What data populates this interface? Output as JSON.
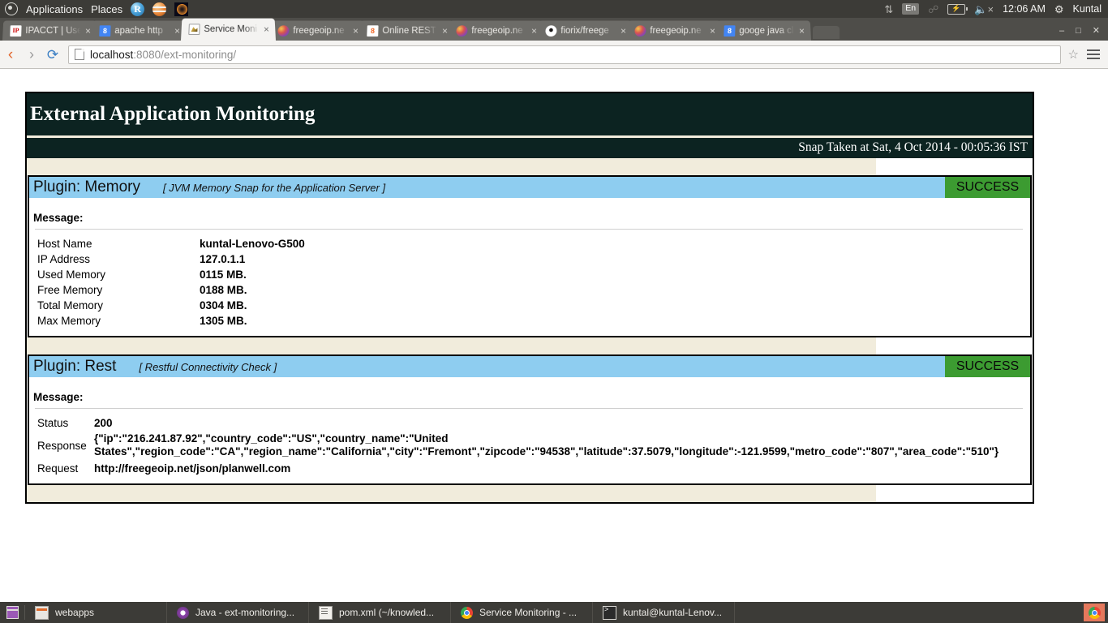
{
  "os_panel": {
    "activities_label": "Applications",
    "places_label": "Places",
    "apps": [
      {
        "name": "r-statistics-icon",
        "label": "R"
      },
      {
        "name": "globe-browser-icon",
        "label": ""
      },
      {
        "name": "eclipse-icon",
        "label": ""
      }
    ],
    "tray": {
      "network_icon": "network-updown-icon",
      "keyboard_layout": "En",
      "bluetooth_icon": "bluetooth-icon",
      "battery_icon": "battery-charging-icon",
      "volume_icon": "volume-muted-icon",
      "clock": "12:06 AM",
      "settings_icon": "gear-icon",
      "user": "Kuntal"
    }
  },
  "browser": {
    "tabs": [
      {
        "title": "IPACCT | Use",
        "favicon": "ipacct-favicon",
        "active": false,
        "close_label": "×"
      },
      {
        "title": "apache http",
        "favicon": "google-8-favicon",
        "active": false,
        "close_label": "×"
      },
      {
        "title": "Service Moni",
        "favicon": "service-monitoring-favicon",
        "active": true,
        "close_label": "×"
      },
      {
        "title": "freegeoip.ne",
        "favicon": "freegeoip-favicon",
        "active": false,
        "close_label": "×"
      },
      {
        "title": "Online REST",
        "favicon": "online-rest-favicon",
        "active": false,
        "close_label": "×"
      },
      {
        "title": "freegeoip.ne",
        "favicon": "freegeoip-favicon",
        "active": false,
        "close_label": "×"
      },
      {
        "title": "fiorix/freege",
        "favicon": "github-favicon",
        "active": false,
        "close_label": "×"
      },
      {
        "title": "freegeoip.ne",
        "favicon": "freegeoip-favicon",
        "active": false,
        "close_label": "×"
      },
      {
        "title": "googe java cl",
        "favicon": "google-8-favicon",
        "active": false,
        "close_label": "×"
      }
    ],
    "window_controls": {
      "minimize": "–",
      "maximize": "□",
      "close": "✕"
    },
    "nav": {
      "back_label": "‹",
      "forward_label": "›",
      "reload_label": "⟳"
    },
    "omnibox": {
      "url_host": "localhost",
      "url_rest": ":8080/ext-monitoring/",
      "bookmark_star": "☆"
    }
  },
  "page": {
    "title": "External Application Monitoring",
    "snap_taken": "Snap Taken at Sat, 4 Oct 2014 - 00:05:36 IST",
    "message_label": "Message:",
    "plugins": [
      {
        "name": "Plugin: Memory",
        "description": "[ JVM Memory Snap for the Application Server ]",
        "status": "SUCCESS",
        "status_color": "#3c9b31",
        "rows": [
          {
            "key": "Host Name",
            "value": "kuntal-Lenovo-G500"
          },
          {
            "key": "IP Address",
            "value": "127.0.1.1"
          },
          {
            "key": "Used Memory",
            "value": "0115 MB."
          },
          {
            "key": "Free Memory",
            "value": "0188 MB."
          },
          {
            "key": "Total Memory",
            "value": "0304 MB."
          },
          {
            "key": "Max Memory",
            "value": "1305 MB."
          }
        ]
      },
      {
        "name": "Plugin: Rest",
        "description": "[ Restful Connectivity Check ]",
        "status": "SUCCESS",
        "status_color": "#3c9b31",
        "rows": [
          {
            "key": "Status",
            "value": "200"
          },
          {
            "key": "Response",
            "value": "{\"ip\":\"216.241.87.92\",\"country_code\":\"US\",\"country_name\":\"United States\",\"region_code\":\"CA\",\"region_name\":\"California\",\"city\":\"Fremont\",\"zipcode\":\"94538\",\"latitude\":37.5079,\"longitude\":-121.9599,\"metro_code\":\"807\",\"area_code\":\"510\"}"
          },
          {
            "key": "Request",
            "value": "http://freegeoip.net/json/planwell.com"
          }
        ]
      }
    ]
  },
  "taskbar": {
    "show_desktop_label": "",
    "items": [
      {
        "label": "webapps",
        "icon": "file-manager-icon"
      },
      {
        "label": "Java - ext-monitoring...",
        "icon": "eclipse-java-icon"
      },
      {
        "label": "pom.xml (~/knowled...",
        "icon": "text-editor-icon"
      },
      {
        "label": "Service Monitoring - ...",
        "icon": "chrome-icon"
      },
      {
        "label": "kuntal@kuntal-Lenov...",
        "icon": "terminal-icon"
      }
    ],
    "tray_icon": "chrome-icon"
  }
}
